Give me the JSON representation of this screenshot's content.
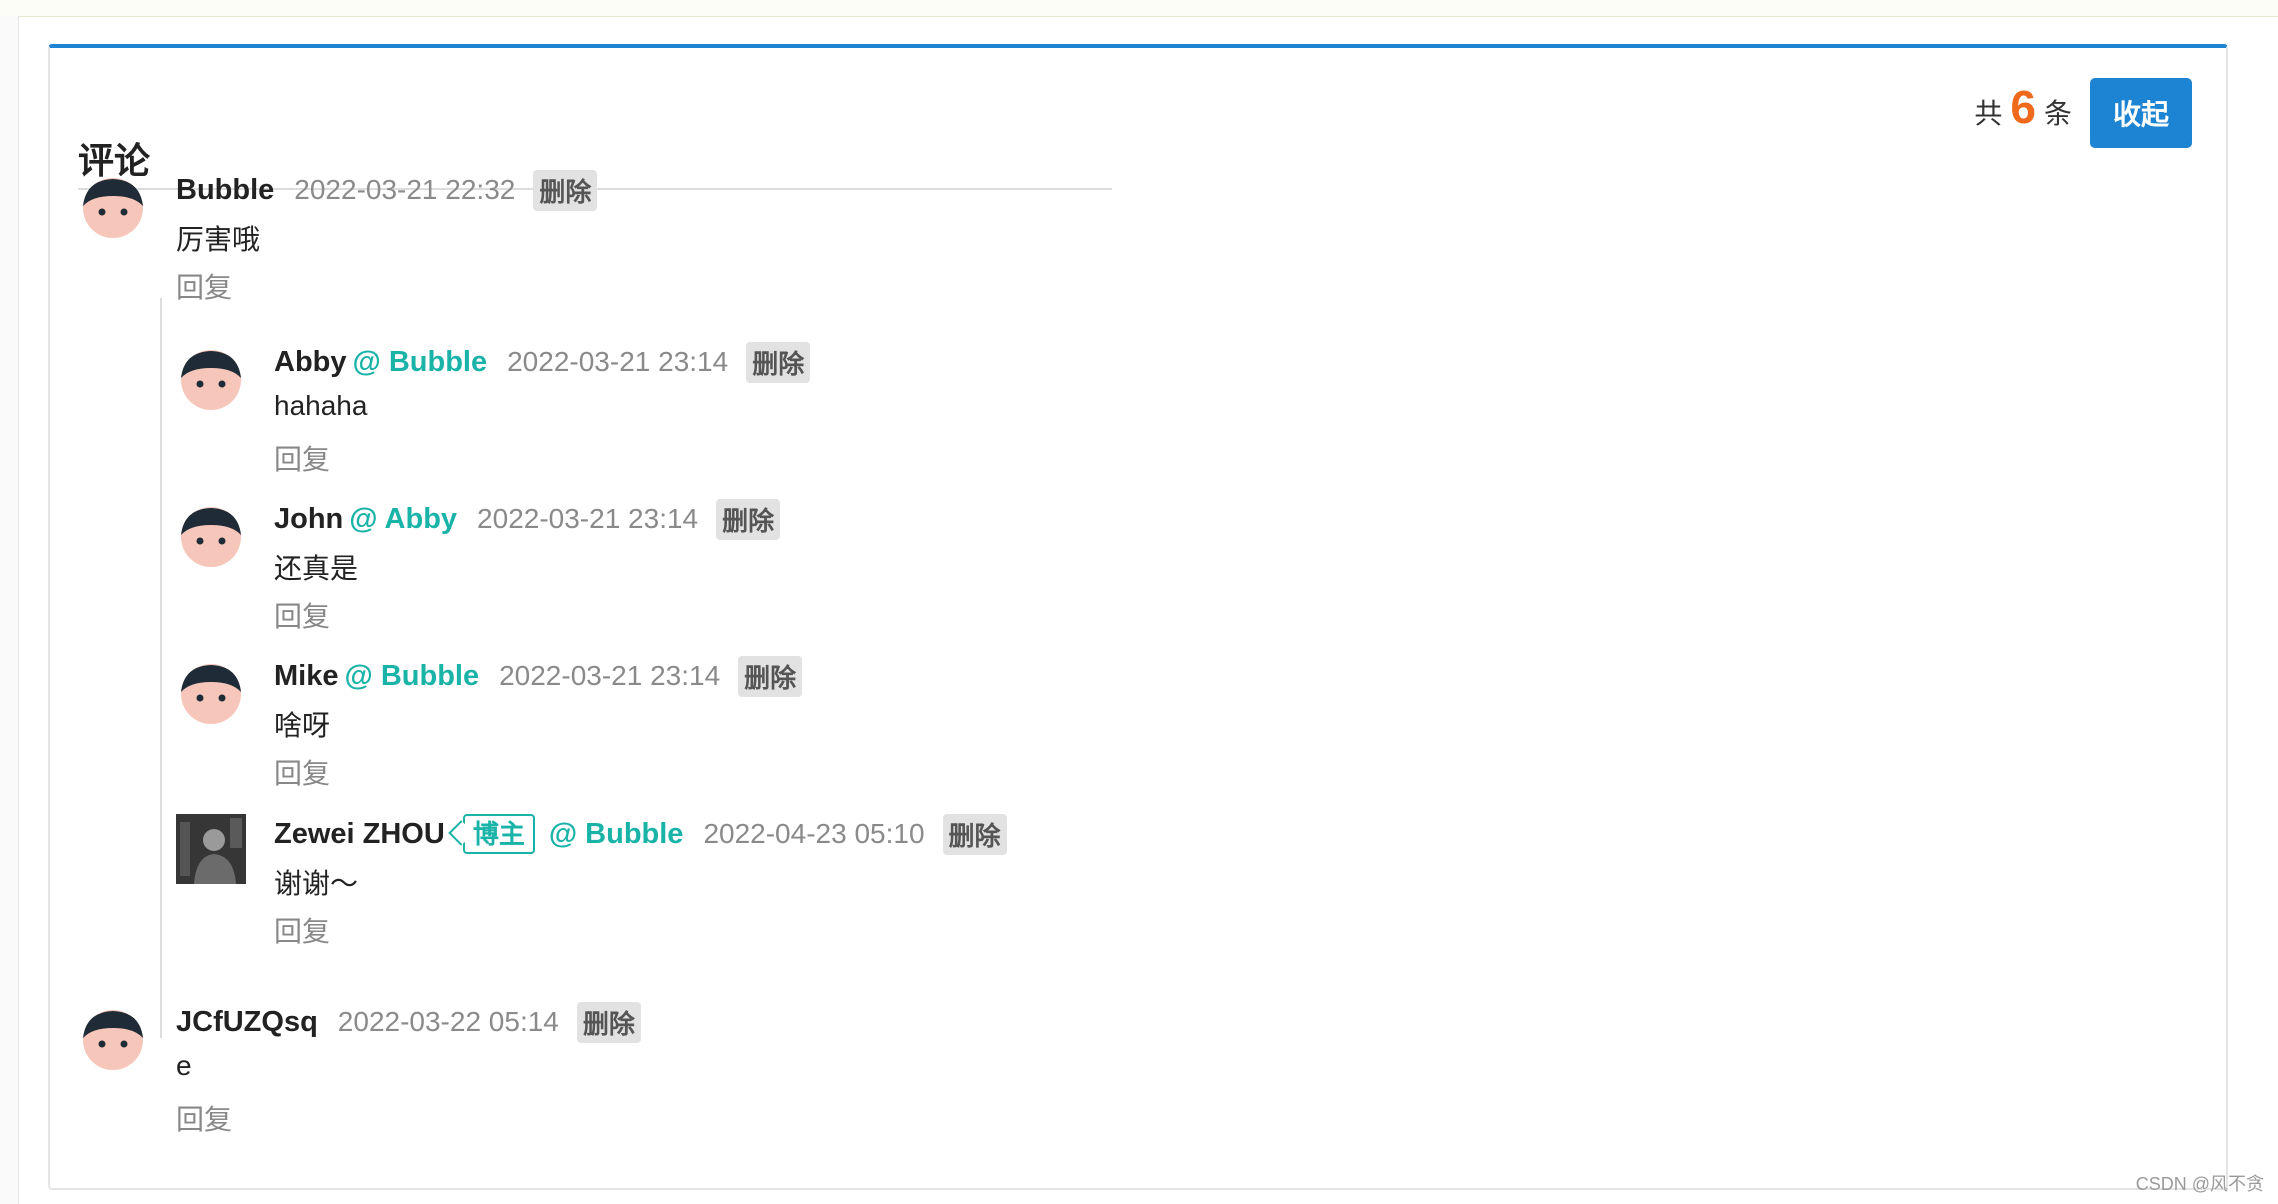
{
  "header": {
    "title": "评论",
    "count_prefix": "共",
    "count": "6",
    "count_suffix": "条",
    "collapse_label": "收起"
  },
  "comments": [
    {
      "author": "Bubble",
      "reply_to": "",
      "time": "2022-03-21 22:32",
      "delete_label": "删除",
      "text": "厉害哦",
      "reply_label": "回复",
      "avatar": "cartoon-face-icon"
    },
    {
      "author": "Abby",
      "reply_to": "@ Bubble",
      "time": "2022-03-21 23:14",
      "delete_label": "删除",
      "text": "hahaha",
      "reply_label": "回复",
      "avatar": "cartoon-face-icon"
    },
    {
      "author": "John",
      "reply_to": "@ Abby",
      "time": "2022-03-21 23:14",
      "delete_label": "删除",
      "text": "还真是",
      "reply_label": "回复",
      "avatar": "cartoon-face-icon"
    },
    {
      "author": "Mike",
      "reply_to": "@ Bubble",
      "time": "2022-03-21 23:14",
      "delete_label": "删除",
      "text": "啥呀",
      "reply_label": "回复",
      "avatar": "cartoon-face-icon"
    },
    {
      "author": "Zewei ZHOU",
      "badge": "博主",
      "reply_to": "@ Bubble",
      "time": "2022-04-23 05:10",
      "delete_label": "删除",
      "text": "谢谢～",
      "reply_label": "回复",
      "avatar": "photo-avatar"
    },
    {
      "author": "JCfUZQsq",
      "reply_to": "",
      "time": "2022-03-22 05:14",
      "delete_label": "删除",
      "text": "e",
      "reply_label": "回复",
      "avatar": "cartoon-face-icon"
    }
  ],
  "watermark": "CSDN @风不贪",
  "colors": {
    "accent": "#1d84d3",
    "count": "#ef6a1b",
    "mention": "#1ab3a8",
    "timestamp": "#8a8a8a"
  }
}
